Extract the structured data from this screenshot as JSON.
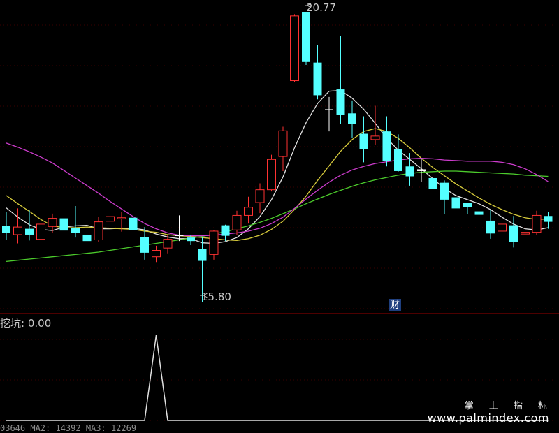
{
  "chart_data": [
    {
      "type": "candlestick",
      "panel": "main",
      "annotations": {
        "high_label": "20.77",
        "low_label": "15.80",
        "badge": "财"
      },
      "candles": [
        {
          "o": 17.1,
          "h": 17.34,
          "l": 16.86,
          "c": 16.98,
          "color": "cyan"
        },
        {
          "o": 16.95,
          "h": 17.4,
          "l": 16.8,
          "c": 17.08,
          "color": "red"
        },
        {
          "o": 17.05,
          "h": 17.38,
          "l": 16.85,
          "c": 16.95,
          "color": "cyan"
        },
        {
          "o": 16.87,
          "h": 17.22,
          "l": 16.68,
          "c": 17.13,
          "color": "red"
        },
        {
          "o": 17.09,
          "h": 17.31,
          "l": 16.98,
          "c": 17.23,
          "color": "red"
        },
        {
          "o": 17.23,
          "h": 17.5,
          "l": 16.95,
          "c": 17.02,
          "color": "cyan"
        },
        {
          "o": 17.06,
          "h": 17.44,
          "l": 16.9,
          "c": 16.98,
          "color": "cyan"
        },
        {
          "o": 16.95,
          "h": 17.12,
          "l": 16.77,
          "c": 16.84,
          "color": "cyan"
        },
        {
          "o": 16.86,
          "h": 17.25,
          "l": 16.83,
          "c": 17.17,
          "color": "red"
        },
        {
          "o": 17.18,
          "h": 17.33,
          "l": 16.95,
          "c": 17.26,
          "color": "red"
        },
        {
          "o": 17.24,
          "h": 17.34,
          "l": 17.0,
          "c": 17.22,
          "color": "red"
        },
        {
          "o": 17.24,
          "h": 17.34,
          "l": 16.95,
          "c": 17.03,
          "color": "cyan"
        },
        {
          "o": 16.91,
          "h": 17.08,
          "l": 16.52,
          "c": 16.64,
          "color": "cyan"
        },
        {
          "o": 16.57,
          "h": 16.76,
          "l": 16.48,
          "c": 16.68,
          "color": "red"
        },
        {
          "o": 16.72,
          "h": 16.95,
          "l": 16.63,
          "c": 16.87,
          "color": "red"
        },
        {
          "o": 16.94,
          "h": 17.28,
          "l": 16.84,
          "c": 16.94,
          "color": "white"
        },
        {
          "o": 16.9,
          "h": 16.95,
          "l": 16.77,
          "c": 16.84,
          "color": "cyan"
        },
        {
          "o": 16.71,
          "h": 16.91,
          "l": 15.8,
          "c": 16.5,
          "color": "cyan"
        },
        {
          "o": 16.61,
          "h": 17.03,
          "l": 16.52,
          "c": 17.01,
          "color": "red"
        },
        {
          "o": 16.93,
          "h": 17.12,
          "l": 16.84,
          "c": 17.11,
          "color": "cyan"
        },
        {
          "o": 17.03,
          "h": 17.36,
          "l": 16.95,
          "c": 17.28,
          "color": "red"
        },
        {
          "o": 17.28,
          "h": 17.6,
          "l": 17.14,
          "c": 17.42,
          "color": "red"
        },
        {
          "o": 17.5,
          "h": 17.83,
          "l": 17.32,
          "c": 17.72,
          "color": "red"
        },
        {
          "o": 17.72,
          "h": 18.32,
          "l": 17.69,
          "c": 18.24,
          "color": "red"
        },
        {
          "o": 18.29,
          "h": 18.8,
          "l": 18.04,
          "c": 18.73,
          "color": "red"
        },
        {
          "o": 19.59,
          "h": 20.73,
          "l": 19.57,
          "c": 20.7,
          "color": "red"
        },
        {
          "o": 20.77,
          "h": 20.75,
          "l": 19.86,
          "c": 19.91,
          "color": "cyan"
        },
        {
          "o": 19.9,
          "h": 20.2,
          "l": 19.27,
          "c": 19.34,
          "color": "cyan"
        },
        {
          "o": 19.1,
          "h": 19.31,
          "l": 18.72,
          "c": 19.09,
          "color": "white"
        },
        {
          "o": 19.44,
          "h": 20.36,
          "l": 18.85,
          "c": 19.0,
          "color": "cyan"
        },
        {
          "o": 19.03,
          "h": 19.25,
          "l": 18.61,
          "c": 18.85,
          "color": "cyan"
        },
        {
          "o": 18.68,
          "h": 18.98,
          "l": 18.19,
          "c": 18.42,
          "color": "cyan"
        },
        {
          "o": 18.64,
          "h": 19.16,
          "l": 18.49,
          "c": 18.58,
          "color": "red"
        },
        {
          "o": 18.72,
          "h": 18.98,
          "l": 18.12,
          "c": 18.21,
          "color": "cyan"
        },
        {
          "o": 18.42,
          "h": 18.67,
          "l": 18.03,
          "c": 18.04,
          "color": "cyan"
        },
        {
          "o": 18.12,
          "h": 18.35,
          "l": 17.79,
          "c": 17.95,
          "color": "cyan"
        },
        {
          "o": 18.07,
          "h": 18.26,
          "l": 17.86,
          "c": 18.04,
          "color": "white"
        },
        {
          "o": 17.92,
          "h": 18.13,
          "l": 17.63,
          "c": 17.73,
          "color": "cyan"
        },
        {
          "o": 17.84,
          "h": 17.88,
          "l": 17.3,
          "c": 17.55,
          "color": "cyan"
        },
        {
          "o": 17.59,
          "h": 17.79,
          "l": 17.35,
          "c": 17.4,
          "color": "cyan"
        },
        {
          "o": 17.5,
          "h": 17.49,
          "l": 17.3,
          "c": 17.42,
          "color": "cyan"
        },
        {
          "o": 17.35,
          "h": 17.46,
          "l": 17.16,
          "c": 17.29,
          "color": "cyan"
        },
        {
          "o": 17.19,
          "h": 17.38,
          "l": 16.88,
          "c": 16.97,
          "color": "cyan"
        },
        {
          "o": 17.01,
          "h": 17.15,
          "l": 16.97,
          "c": 17.13,
          "color": "red"
        },
        {
          "o": 17.11,
          "h": 17.27,
          "l": 16.73,
          "c": 16.82,
          "color": "cyan"
        },
        {
          "o": 16.99,
          "h": 17.02,
          "l": 16.93,
          "c": 16.96,
          "color": "red"
        },
        {
          "o": 16.99,
          "h": 17.36,
          "l": 16.95,
          "c": 17.28,
          "color": "red"
        },
        {
          "o": 17.27,
          "h": 17.34,
          "l": 17.05,
          "c": 17.17,
          "color": "cyan"
        }
      ],
      "ma_lines": [
        {
          "color": "#e0e0e0",
          "values": [
            17.41,
            17.25,
            17.12,
            17.04,
            17.02,
            17.08,
            17.1,
            17.11,
            17.05,
            17.05,
            17.06,
            17.06,
            17.03,
            16.96,
            16.91,
            16.88,
            16.88,
            16.81,
            16.8,
            16.83,
            16.9,
            17.05,
            17.26,
            17.55,
            17.94,
            18.44,
            18.87,
            19.2,
            19.41,
            19.42,
            19.29,
            19.1,
            18.86,
            18.6,
            18.4,
            18.24,
            18.08,
            17.91,
            17.74,
            17.62,
            17.55,
            17.48,
            17.38,
            17.25,
            17.13,
            17.05,
            17.03,
            17.07
          ]
        },
        {
          "color": "#d8cc3c",
          "values": [
            17.62,
            17.48,
            17.35,
            17.21,
            17.1,
            17.07,
            17.07,
            17.08,
            17.07,
            17.06,
            17.05,
            17.04,
            17.01,
            16.99,
            16.95,
            16.93,
            16.92,
            16.9,
            16.88,
            16.86,
            16.85,
            16.88,
            16.94,
            17.04,
            17.18,
            17.38,
            17.61,
            17.88,
            18.13,
            18.38,
            18.58,
            18.72,
            18.77,
            18.72,
            18.6,
            18.44,
            18.26,
            18.1,
            17.96,
            17.82,
            17.7,
            17.58,
            17.47,
            17.38,
            17.3,
            17.24,
            17.21,
            17.22
          ]
        },
        {
          "color": "#4ccc2c",
          "values": [
            16.49,
            16.51,
            16.53,
            16.55,
            16.57,
            16.59,
            16.61,
            16.63,
            16.65,
            16.68,
            16.71,
            16.74,
            16.77,
            16.8,
            16.83,
            16.86,
            16.89,
            16.92,
            16.96,
            17.0,
            17.05,
            17.1,
            17.16,
            17.23,
            17.31,
            17.39,
            17.48,
            17.56,
            17.64,
            17.71,
            17.78,
            17.84,
            17.89,
            17.93,
            17.97,
            18.0,
            18.02,
            18.03,
            18.04,
            18.04,
            18.03,
            18.02,
            18.01,
            18.0,
            17.99,
            17.97,
            17.96,
            17.95
          ]
        },
        {
          "color": "#cc3ccc",
          "values": [
            18.52,
            18.45,
            18.37,
            18.28,
            18.18,
            18.05,
            17.92,
            17.79,
            17.66,
            17.52,
            17.39,
            17.26,
            17.14,
            17.05,
            16.98,
            16.94,
            16.93,
            16.93,
            16.94,
            16.96,
            16.98,
            17.01,
            17.06,
            17.14,
            17.25,
            17.4,
            17.56,
            17.71,
            17.85,
            17.97,
            18.06,
            18.12,
            18.17,
            18.2,
            18.23,
            18.25,
            18.26,
            18.25,
            18.23,
            18.22,
            18.21,
            18.21,
            18.21,
            18.19,
            18.15,
            18.08,
            17.98,
            17.86
          ]
        }
      ]
    },
    {
      "type": "line",
      "panel": "indicator",
      "title": "挖坑",
      "current_value": "0.00",
      "values": [
        0,
        0,
        0,
        0,
        0,
        0,
        0,
        0,
        0,
        0,
        0,
        0,
        0,
        1,
        0,
        0,
        0,
        0,
        0,
        0,
        0,
        0,
        0,
        0,
        0,
        0,
        0,
        0,
        0,
        0,
        0,
        0,
        0,
        0,
        0,
        0,
        0,
        0,
        0,
        0,
        0,
        0,
        0,
        0,
        0,
        0,
        0,
        0
      ]
    }
  ],
  "watermark": {
    "cn": "掌 上 指 标",
    "url": "www.palmindex.com"
  },
  "formula_tail": "03646 MA2: 14392 MA3: 12269"
}
